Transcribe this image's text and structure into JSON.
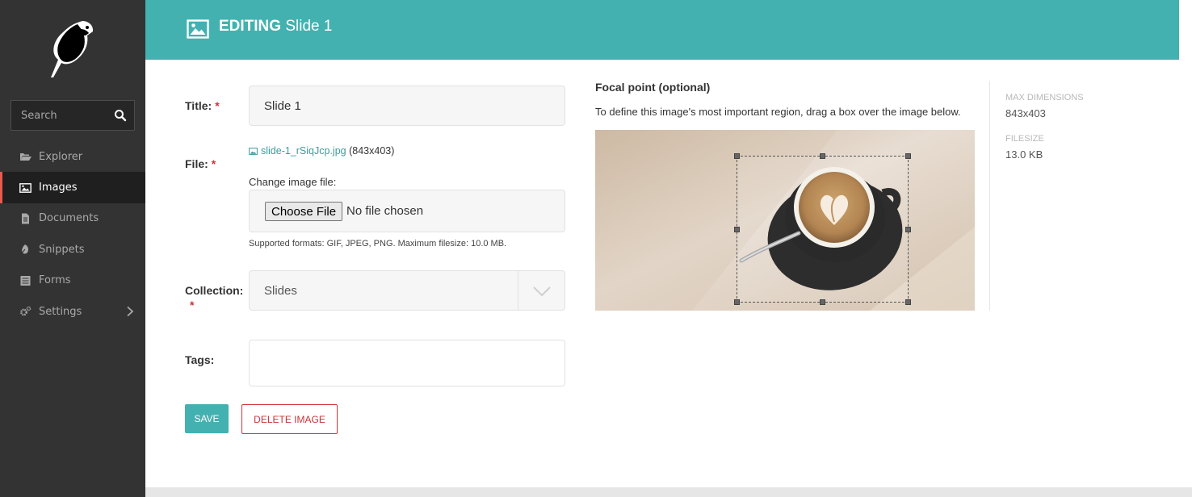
{
  "header": {
    "title_strong": "EDITING",
    "title_light": "Slide 1"
  },
  "sidebar": {
    "search_placeholder": "Search",
    "items": [
      {
        "label": "Explorer",
        "icon": "folder-open-icon"
      },
      {
        "label": "Images",
        "icon": "image-icon",
        "active": true
      },
      {
        "label": "Documents",
        "icon": "document-icon"
      },
      {
        "label": "Snippets",
        "icon": "snippet-icon"
      },
      {
        "label": "Forms",
        "icon": "form-icon"
      },
      {
        "label": "Settings",
        "icon": "cogs-icon",
        "has_submenu": true
      }
    ]
  },
  "form": {
    "title_label": "Title:",
    "title_value": "Slide 1",
    "file_label": "File:",
    "file_name": "slide-1_rSiqJcp.jpg",
    "file_dims": "(843x403)",
    "change_label": "Change image file:",
    "choose_button": "Choose File",
    "no_file": "No file chosen",
    "help_text": "Supported formats: GIF, JPEG, PNG. Maximum filesize: 10.0 MB.",
    "collection_label": "Collection:",
    "collection_value": "Slides",
    "tags_label": "Tags:",
    "tags_value": "",
    "required_mark": "*",
    "save_button": "SAVE",
    "delete_button": "DELETE IMAGE"
  },
  "focal": {
    "title": "Focal point (optional)",
    "help": "To define this image's most important region, drag a box over the image below."
  },
  "meta": {
    "dimensions_label": "MAX DIMENSIONS",
    "dimensions_value": "843x403",
    "filesize_label": "FILESIZE",
    "filesize_value": "13.0 KB"
  },
  "colors": {
    "accent": "#43b1b0",
    "sidebar": "#333333",
    "danger": "#cd3238"
  }
}
